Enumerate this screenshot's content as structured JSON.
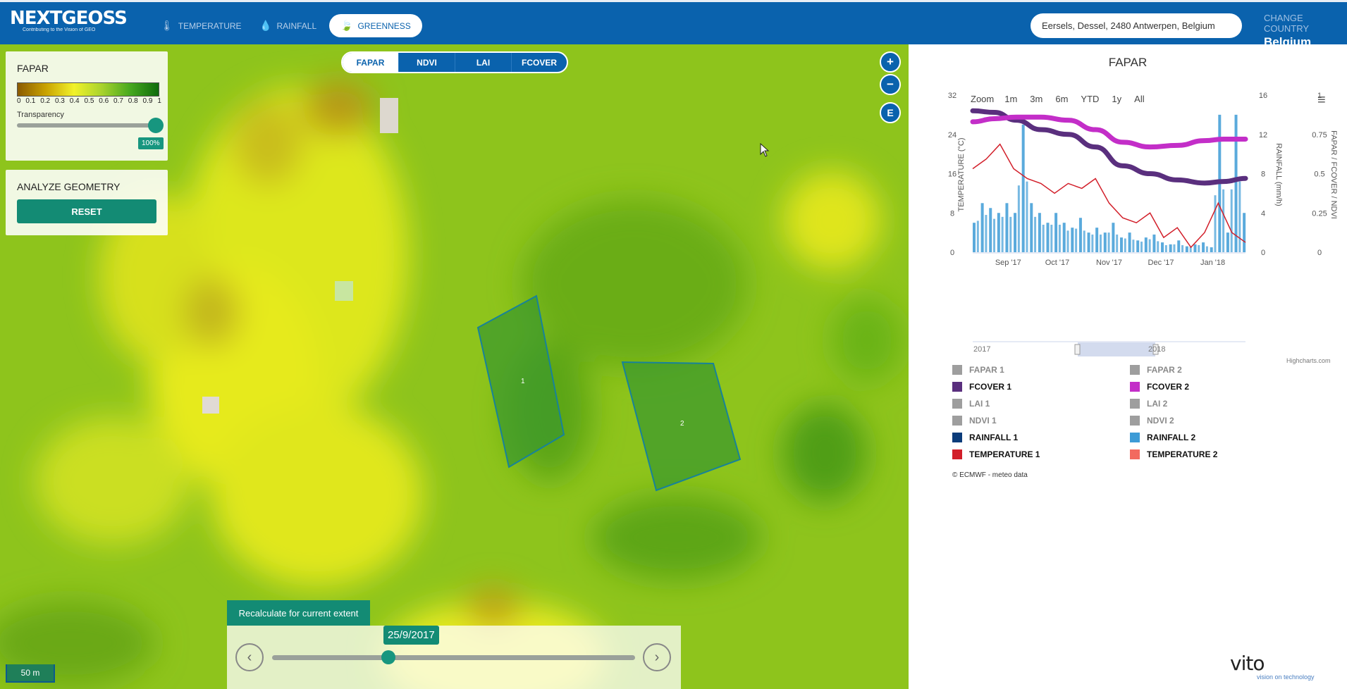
{
  "app": {
    "logo": "NEXTGEOSS",
    "logo_sub": "Contributing to the Vision of GEO"
  },
  "nav": {
    "tabs": [
      {
        "label": "TEMPERATURE",
        "icon": "thermometer-icon"
      },
      {
        "label": "RAINFALL",
        "icon": "raindrop-icon"
      },
      {
        "label": "GREENNESS",
        "icon": "leaf-icon",
        "active": true
      }
    ],
    "search_value": "Eersels, Dessel, 2480 Antwerpen, Belgium",
    "change_country_label": "CHANGE COUNTRY",
    "country": "Belgium"
  },
  "map": {
    "legend": {
      "title": "FAPAR",
      "ticks": [
        "0",
        "0.1",
        "0.2",
        "0.3",
        "0.4",
        "0.5",
        "0.6",
        "0.7",
        "0.8",
        "0.9",
        "1"
      ],
      "transparency_label": "Transparency",
      "transparency_value": "100%"
    },
    "analyze": {
      "title": "ANALYZE GEOMETRY",
      "reset_label": "RESET"
    },
    "layer_tabs": [
      "FAPAR",
      "NDVI",
      "LAI",
      "FCOVER"
    ],
    "active_layer": "FAPAR",
    "zoom_in": "+",
    "zoom_out": "−",
    "extent_button": "E",
    "polygons": [
      "1",
      "2"
    ],
    "recalculate_label": "Recalculate for current extent",
    "date": "25/9/2017",
    "time_progress": 0.32,
    "transparency_level": 1.0,
    "scale_label": "50 m"
  },
  "chart_panel": {
    "title": "FAPAR",
    "zoom_label": "Zoom",
    "zoom_options": [
      "1m",
      "3m",
      "6m",
      "YTD",
      "1y",
      "All"
    ],
    "navigator_labels": [
      "2017",
      "2018"
    ],
    "highcharts_credit": "Highcharts.com",
    "copyright": "© ECMWF - meteo data"
  },
  "chart_data": {
    "type": "line",
    "title": "FAPAR",
    "x_tick_labels": [
      "Sep '17",
      "Oct '17",
      "Nov '17",
      "Dec '17",
      "Jan '18"
    ],
    "axes": {
      "temperature": {
        "label": "TEMPERATURE (°C)",
        "range": [
          0,
          32
        ],
        "ticks": [
          "0",
          "8",
          "16",
          "24",
          "32"
        ]
      },
      "rainfall": {
        "label": "RAINFALL (mm/h)",
        "range": [
          0,
          16
        ],
        "ticks": [
          "0",
          "4",
          "8",
          "12",
          "16"
        ]
      },
      "index": {
        "label": "FAPAR / FCOVER / NDVI",
        "range": [
          0,
          1
        ],
        "ticks": [
          "0",
          "0.25",
          "0.5",
          "0.75",
          "1"
        ]
      }
    },
    "x_range": [
      0,
      1
    ],
    "series": [
      {
        "name": "FCOVER 1",
        "axis": "index",
        "color": "#5a2f7e",
        "x": [
          0.0,
          0.08,
          0.16,
          0.25,
          0.35,
          0.45,
          0.55,
          0.65,
          0.75,
          0.85,
          0.92,
          1.0
        ],
        "values": [
          0.9,
          0.89,
          0.84,
          0.78,
          0.75,
          0.67,
          0.55,
          0.5,
          0.46,
          0.44,
          0.45,
          0.47
        ]
      },
      {
        "name": "FCOVER 2",
        "axis": "index",
        "color": "#c32ec8",
        "x": [
          0.0,
          0.08,
          0.16,
          0.25,
          0.35,
          0.45,
          0.55,
          0.65,
          0.75,
          0.85,
          0.92,
          1.0
        ],
        "values": [
          0.83,
          0.85,
          0.86,
          0.86,
          0.84,
          0.78,
          0.7,
          0.67,
          0.68,
          0.71,
          0.72,
          0.72
        ]
      },
      {
        "name": "TEMPERATURE 1",
        "axis": "temperature",
        "color": "#d21f2a",
        "x": [
          0.0,
          0.05,
          0.1,
          0.15,
          0.2,
          0.25,
          0.3,
          0.35,
          0.4,
          0.45,
          0.5,
          0.55,
          0.6,
          0.65,
          0.7,
          0.75,
          0.8,
          0.85,
          0.9,
          0.95,
          1.0
        ],
        "values": [
          17,
          19,
          22,
          17,
          15,
          14,
          12,
          14,
          13,
          15,
          10,
          7,
          6,
          8,
          3,
          5,
          1,
          4,
          10,
          4,
          2
        ]
      },
      {
        "name": "RAINFALL 2",
        "axis": "rainfall",
        "color": "#3d9bd6",
        "x": [
          0.0,
          0.03,
          0.06,
          0.09,
          0.12,
          0.15,
          0.18,
          0.21,
          0.24,
          0.27,
          0.3,
          0.33,
          0.36,
          0.39,
          0.42,
          0.45,
          0.48,
          0.51,
          0.54,
          0.57,
          0.6,
          0.63,
          0.66,
          0.69,
          0.72,
          0.75,
          0.78,
          0.81,
          0.84,
          0.87,
          0.9,
          0.93,
          0.96,
          0.99
        ],
        "values": [
          3,
          5,
          4.5,
          4,
          5,
          4,
          13,
          5,
          4,
          3,
          4,
          3,
          2.5,
          3.5,
          2,
          2.5,
          2,
          3,
          1.5,
          2,
          1.2,
          1.5,
          1.8,
          1,
          0.8,
          1.2,
          0.6,
          0.8,
          1,
          0.5,
          14,
          2,
          14,
          4
        ]
      }
    ],
    "legend_entries": [
      {
        "name": "FAPAR 1",
        "color": "#9e9e9e",
        "active": false
      },
      {
        "name": "FAPAR 2",
        "color": "#9e9e9e",
        "active": false
      },
      {
        "name": "FCOVER 1",
        "color": "#5a2f7e",
        "active": true
      },
      {
        "name": "FCOVER 2",
        "color": "#c32ec8",
        "active": true
      },
      {
        "name": "LAI 1",
        "color": "#9e9e9e",
        "active": false
      },
      {
        "name": "LAI 2",
        "color": "#9e9e9e",
        "active": false
      },
      {
        "name": "NDVI 1",
        "color": "#9e9e9e",
        "active": false
      },
      {
        "name": "NDVI 2",
        "color": "#9e9e9e",
        "active": false
      },
      {
        "name": "RAINFALL 1",
        "color": "#0b3c7a",
        "active": true
      },
      {
        "name": "RAINFALL 2",
        "color": "#3d9bd6",
        "active": true
      },
      {
        "name": "TEMPERATURE 1",
        "color": "#d21f2a",
        "active": true
      },
      {
        "name": "TEMPERATURE 2",
        "color": "#f26a5f",
        "active": true
      }
    ],
    "legend_placement": "bottom",
    "grid": false
  },
  "footer": {
    "brand": "vito",
    "brand_sub": "vision on technology"
  },
  "colors": {
    "primary": "#0a62ad",
    "accent": "#138b74"
  }
}
